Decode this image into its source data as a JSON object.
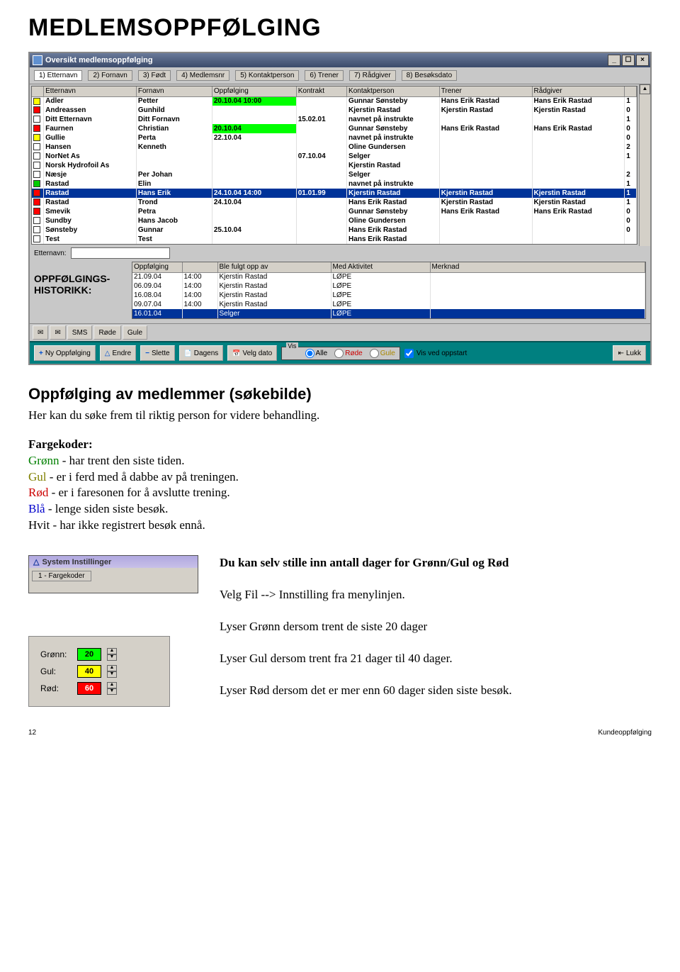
{
  "doc_title": "MEDLEMSOPPFØLGING",
  "window": {
    "title": "Oversikt medlemsoppfølging",
    "min": "_",
    "restore": "☐",
    "close": "×"
  },
  "tabs": [
    "1) Etternavn",
    "2) Fornavn",
    "3) Født",
    "4) Medlemsnr",
    "5) Kontaktperson",
    "6) Trener",
    "7) Rådgiver",
    "8) Besøksdato"
  ],
  "headers": [
    "",
    "Etternavn",
    "Fornavn",
    "Oppfølging",
    "Kontrakt",
    "Kontaktperson",
    "Trener",
    "Rådgiver",
    ""
  ],
  "rows": [
    {
      "c": "#ffff00",
      "e": "Adler",
      "f": "Petter",
      "o": "20.10.04 10:00",
      "oh": true,
      "k": "",
      "kp": "Gunnar Sønsteby",
      "t": "Hans Erik Rastad",
      "r": "Hans Erik Rastad",
      "n": "1"
    },
    {
      "c": "#ff0000",
      "e": "Andreassen",
      "f": "Gunhild",
      "o": "",
      "k": "",
      "kp": "Kjerstin Rastad",
      "t": "Kjerstin Rastad",
      "r": "Kjerstin Rastad",
      "n": "0"
    },
    {
      "c": "",
      "e": "Ditt Etternavn",
      "f": "Ditt Fornavn",
      "o": "",
      "k": "15.02.01",
      "kp": "navnet på instrukte",
      "t": "",
      "r": "",
      "n": "1"
    },
    {
      "c": "#ff0000",
      "e": "Faurnen",
      "f": "Christian",
      "o": "20.10.04",
      "oh": true,
      "k": "",
      "kp": "Gunnar Sønsteby",
      "t": "Hans Erik Rastad",
      "r": "Hans Erik Rastad",
      "n": "0"
    },
    {
      "c": "#ffff00",
      "e": "Gullie",
      "f": "Perta",
      "o": "22.10.04",
      "k": "",
      "kp": "navnet på instrukte",
      "t": "",
      "r": "",
      "n": "0"
    },
    {
      "c": "",
      "e": "Hansen",
      "f": "Kenneth",
      "o": "",
      "k": "",
      "kp": "Oline Gundersen",
      "t": "",
      "r": "",
      "n": "2"
    },
    {
      "c": "",
      "e": "NorNet As",
      "f": "",
      "o": "",
      "k": "07.10.04",
      "kp": "Selger",
      "t": "",
      "r": "",
      "n": "1"
    },
    {
      "c": "",
      "e": "Norsk Hydrofoil As",
      "f": "",
      "o": "",
      "k": "",
      "kp": "Kjerstin Rastad",
      "t": "",
      "r": "",
      "n": ""
    },
    {
      "c": "",
      "e": "Næsje",
      "f": "Per Johan",
      "o": "",
      "k": "",
      "kp": "Selger",
      "t": "",
      "r": "",
      "n": "2"
    },
    {
      "c": "#00cc00",
      "e": "Rastad",
      "f": "Elin",
      "o": "",
      "k": "",
      "kp": "navnet på instrukte",
      "t": "",
      "r": "",
      "n": "1"
    },
    {
      "sel": true,
      "c": "#ff0000",
      "e": "Rastad",
      "f": "Hans Erik",
      "o": "24.10.04 14:00",
      "k": "01.01.99",
      "kp": "Kjerstin Rastad",
      "t": "Kjerstin Rastad",
      "r": "Kjerstin Rastad",
      "n": "1"
    },
    {
      "c": "#ff0000",
      "e": "Rastad",
      "f": "Trond",
      "o": "24.10.04",
      "k": "",
      "kp": "Hans Erik Rastad",
      "t": "Kjerstin Rastad",
      "r": "Kjerstin Rastad",
      "n": "1"
    },
    {
      "c": "#ff0000",
      "e": "Smevik",
      "f": "Petra",
      "o": "",
      "k": "",
      "kp": "Gunnar Sønsteby",
      "t": "Hans Erik Rastad",
      "r": "Hans Erik Rastad",
      "n": "0"
    },
    {
      "c": "",
      "e": "Sundby",
      "f": "Hans Jacob",
      "o": "",
      "k": "",
      "kp": "Oline Gundersen",
      "t": "",
      "r": "",
      "n": "0"
    },
    {
      "c": "",
      "e": "Sønsteby",
      "f": "Gunnar",
      "o": "25.10.04",
      "k": "",
      "kp": "Hans Erik Rastad",
      "t": "",
      "r": "",
      "n": "0"
    },
    {
      "c": "",
      "e": "Test",
      "f": "Test",
      "o": "",
      "k": "",
      "kp": "Hans Erik Rastad",
      "t": "",
      "r": "",
      "n": ""
    }
  ],
  "etternavn_label": "Etternavn:",
  "history_label": "OPPFØLGINGS-\nHISTORIKK:",
  "history_headers": [
    "Oppfølging",
    "",
    "Ble fulgt opp av",
    "Med Aktivitet",
    "Merknad"
  ],
  "history_rows": [
    [
      "21.09.04",
      "14:00",
      "Kjerstin Rastad",
      "LØPE",
      ""
    ],
    [
      "06.09.04",
      "14:00",
      "Kjerstin Rastad",
      "LØPE",
      ""
    ],
    [
      "16.08.04",
      "14:00",
      "Kjerstin Rastad",
      "LØPE",
      ""
    ],
    [
      "09.07.04",
      "14:00",
      "Kjerstin Rastad",
      "LØPE",
      ""
    ],
    [
      "16.01.04",
      "",
      "Selger",
      "LØPE",
      ""
    ]
  ],
  "sms_bar": {
    "sms": "SMS",
    "rode": "Røde",
    "gule": "Gule"
  },
  "teal": {
    "ny": "Ny Oppfølging",
    "endre": "Endre",
    "slette": "Slette",
    "dagens": "Dagens",
    "velg": "Velg dato",
    "vis": "Vis",
    "alle": "Alle",
    "rode": "Røde",
    "gule": "Gule",
    "oppstart": "Vis ved oppstart",
    "lukk": "Lukk"
  },
  "body": {
    "h2": "Oppfølging av medlemmer (søkebilde)",
    "p1": "Her kan du søke frem til riktig person for videre behandling.",
    "farge_h": "Fargekoder:",
    "l_gronn": "Grønn",
    "l_gronn_t": " - har trent den siste tiden.",
    "l_gul": "Gul",
    "l_gul_t": "   - er i ferd med å dabbe av på treningen.",
    "l_rod": "Rød",
    "l_rod_t": " - er i faresonen for å avslutte trening.",
    "l_bla": "Blå",
    "l_bla_t": " - lenge siden siste besøk.",
    "l_hvit": "Hvit",
    "l_hvit_t": " - har ikke registrert besøk ennå."
  },
  "settings": {
    "title": "System Instillinger",
    "tab": "1 - Fargekoder",
    "gronn_l": "Grønn:",
    "gul_l": "Gul:",
    "rod_l": "Rød:",
    "gronn_v": "20",
    "gul_v": "40",
    "rod_v": "60"
  },
  "right": {
    "h": "Du kan selv stille inn antall dager for Grønn/Gul og Rød",
    "p1": "Velg Fil --> Innstilling fra menylinjen.",
    "p2": "Lyser Grønn dersom trent de siste 20 dager",
    "p3": "Lyser Gul dersom trent fra 21 dager til 40 dager.",
    "p4": "Lyser Rød dersom det er mer enn 60 dager siden siste besøk."
  },
  "footer": {
    "page": "12",
    "section": "Kundeoppfølging"
  }
}
